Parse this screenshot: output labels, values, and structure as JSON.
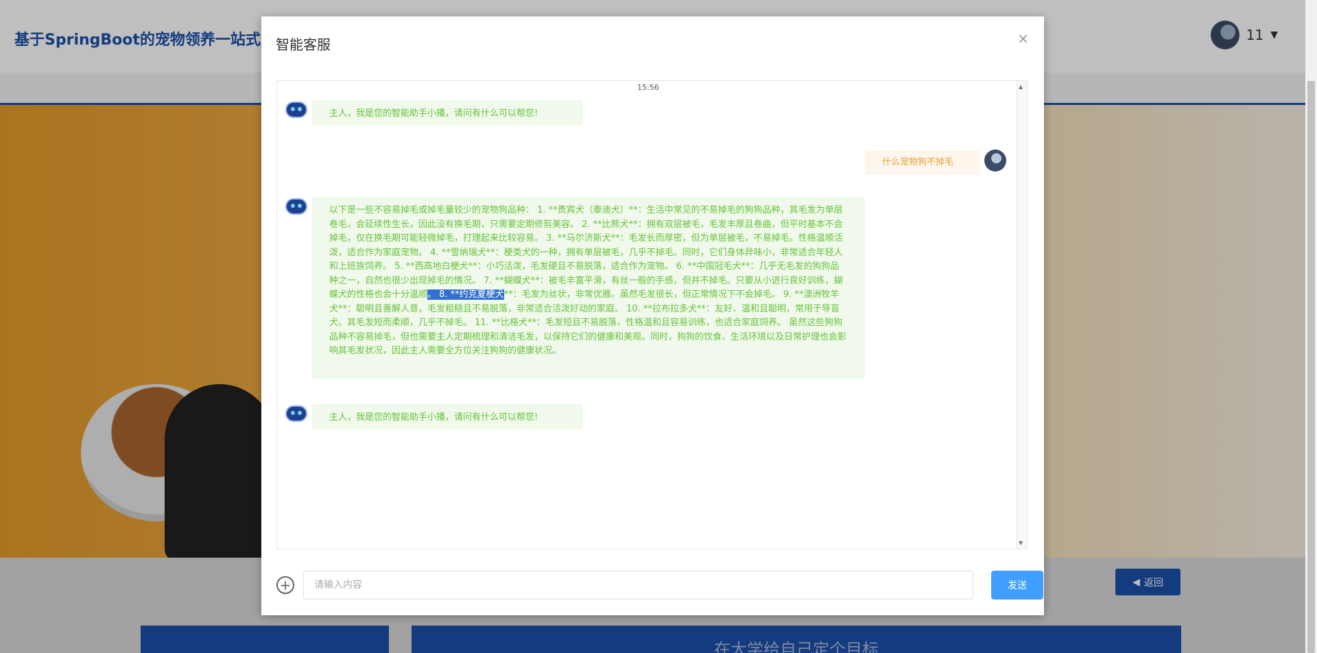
{
  "page": {
    "site_title": "基于SpringBoot的宠物领养一站式服",
    "username": "11",
    "back_label": "返回",
    "banner_heading": "在大学给自己定个目标"
  },
  "modal": {
    "title": "智能客服",
    "close_label": "×",
    "timestamp": "15:56",
    "messages": [
      {
        "role": "bot",
        "text": "主人，我是您的智能助手小播，请问有什么可以帮您!"
      },
      {
        "role": "user",
        "text": "什么宠物狗不掉毛"
      },
      {
        "role": "bot",
        "text_before": "以下是一些不容易掉毛或掉毛量较少的宠物狗品种： 1. **贵宾犬（泰迪犬）**：生活中常见的不易掉毛的狗狗品种，其毛发为单层卷毛，会延续性生长，因此没有换毛期，只需要定期修剪美容。 2. **比熊犬**：拥有双层被毛，毛发丰厚且卷曲，但平时基本不会掉毛，仅在换毛期可能轻微掉毛，打理起来比较容易。 3. **马尔济斯犬**：毛发长而厚密，但为单层被毛，不易掉毛。性格温顺活泼，适合作为家庭宠物。 4. **雪纳瑞犬**：梗类犬的一种，拥有单层被毛，几乎不掉毛。同时，它们身体异味小，非常适合年轻人和上班族饲养。 5. **西高地白梗犬**：小巧活泼，毛发硬且不易脱落，适合作为宠物。 6. **中国冠毛犬**：几乎无毛发的狗狗品种之一，自然也很少出现掉毛的情况。 7. **蝴蝶犬**：被毛丰富平滑，有丝一般的手感，但并不掉毛。只要从小进行良好训练，蝴蝶犬的性格也会十分温顺",
        "text_selected": "。 8. **约克夏梗犬",
        "text_after": "**：毛发为丝状，非常优雅。虽然毛发很长，但正常情况下不会掉毛。 9. **澳洲牧羊犬**：聪明且善解人意，毛发粗糙且不易脱落，非常适合活泼好动的家庭。 10. **拉布拉多犬**：友好、温和且聪明，常用于导盲犬。其毛发短而柔顺，几乎不掉毛。 11. **比格犬**：毛发短且不易脱落，性格温和且容易训练，也适合家庭饲养。 虽然这些狗狗品种不容易掉毛，但也需要主人定期梳理和清洁毛发，以保持它们的健康和美观。同时，狗狗的饮食、生活环境以及日常护理也会影响其毛发状况，因此主人需要全方位关注狗狗的健康状况。"
      },
      {
        "role": "bot",
        "text": "主人，我是您的智能助手小播，请问有什么可以帮您!"
      }
    ],
    "input_placeholder": "请输入内容",
    "input_value": "",
    "send_label": "发送"
  },
  "icons": {
    "add": "plus-circle-icon",
    "close": "close-icon",
    "back": "caret-left-icon",
    "user_menu": "caret-down-icon"
  },
  "colors": {
    "brand": "#1a4fa8",
    "bot_bubble_bg": "#f0f9eb",
    "bot_text": "#67c23a",
    "user_bubble_bg": "#fdf6ec",
    "user_text": "#e6a23c",
    "send_button": "#409eff",
    "selection": "#2f6fd1"
  }
}
